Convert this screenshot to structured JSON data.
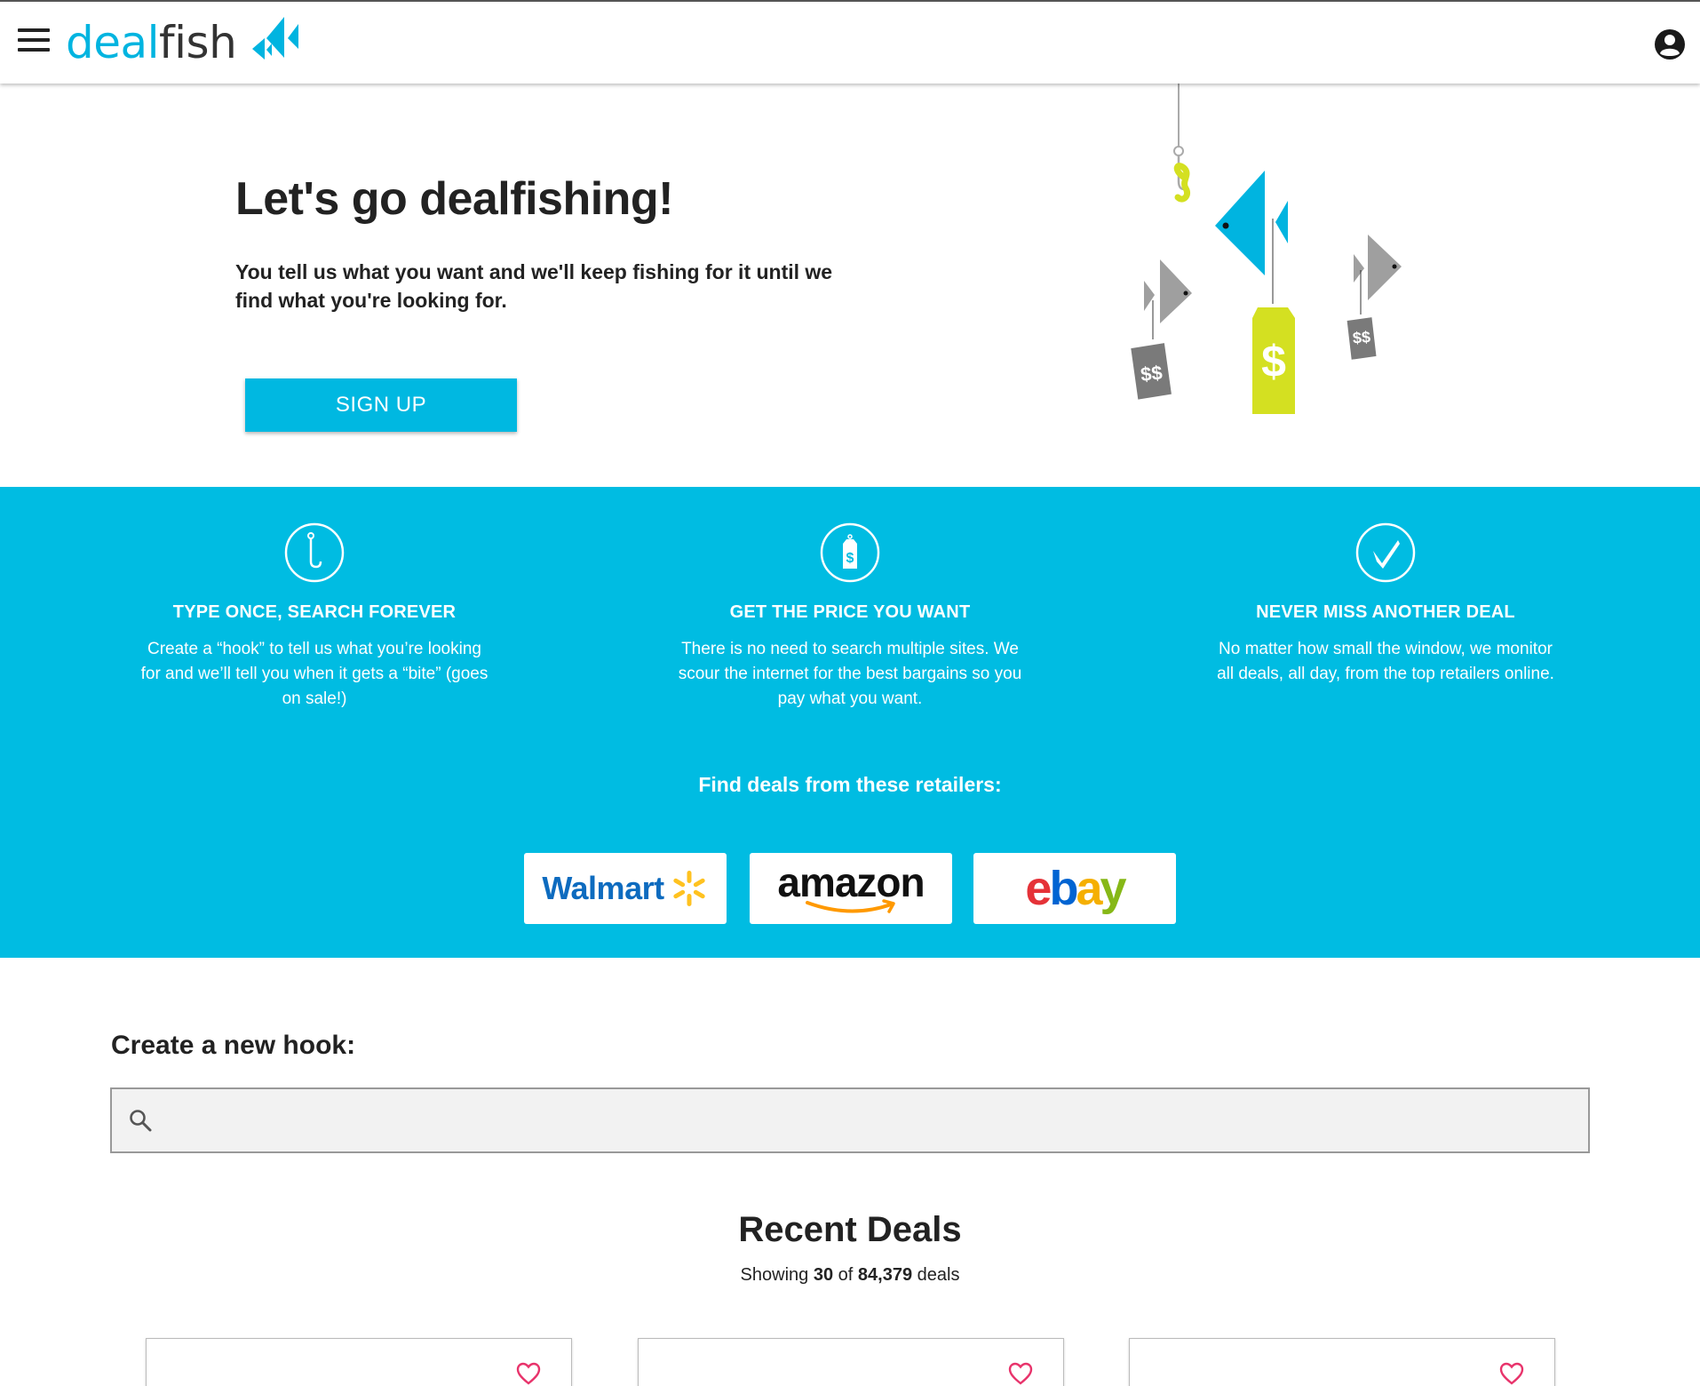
{
  "header": {
    "logo_part1": "deal",
    "logo_part2": "fish",
    "menu_icon": "hamburger-menu-icon",
    "account_icon": "account-circle-icon"
  },
  "hero": {
    "title": "Let's go dealfishing!",
    "subtitle": "You tell us what you want and we'll keep fishing for it until we find what you're looking for.",
    "signup_label": "SIGN UP",
    "tag_small_left": "$$",
    "tag_center": "$",
    "tag_small_right": "$$"
  },
  "features": [
    {
      "icon": "hook-icon",
      "title": "TYPE ONCE, SEARCH FOREVER",
      "text": "Create a “hook” to tell us what you’re looking for and we’ll tell you when it gets a “bite” (goes on sale!)"
    },
    {
      "icon": "price-tag-icon",
      "title": "GET THE PRICE YOU WANT",
      "text": "There is no need to search multiple sites. We scour the internet for the best bargains so you pay what you want."
    },
    {
      "icon": "checkmark-icon",
      "title": "NEVER MISS ANOTHER DEAL",
      "text": "No matter how small the window, we monitor all deals, all day, from the top retailers online."
    }
  ],
  "retailers": {
    "title": "Find deals from these retailers:",
    "walmart": "Walmart",
    "amazon": "amazon",
    "ebay_e": "e",
    "ebay_b": "b",
    "ebay_a": "a",
    "ebay_y": "y"
  },
  "hook": {
    "title": "Create a new hook:",
    "search_placeholder": "",
    "search_value": ""
  },
  "recent": {
    "title": "Recent Deals",
    "showing_prefix": "Showing",
    "shown": "30",
    "of_word": "of",
    "total": "84,379",
    "suffix": "deals"
  },
  "colors": {
    "brand_blue": "#00bce2",
    "lime": "#d4e021",
    "heart_pink": "#e8336b"
  }
}
